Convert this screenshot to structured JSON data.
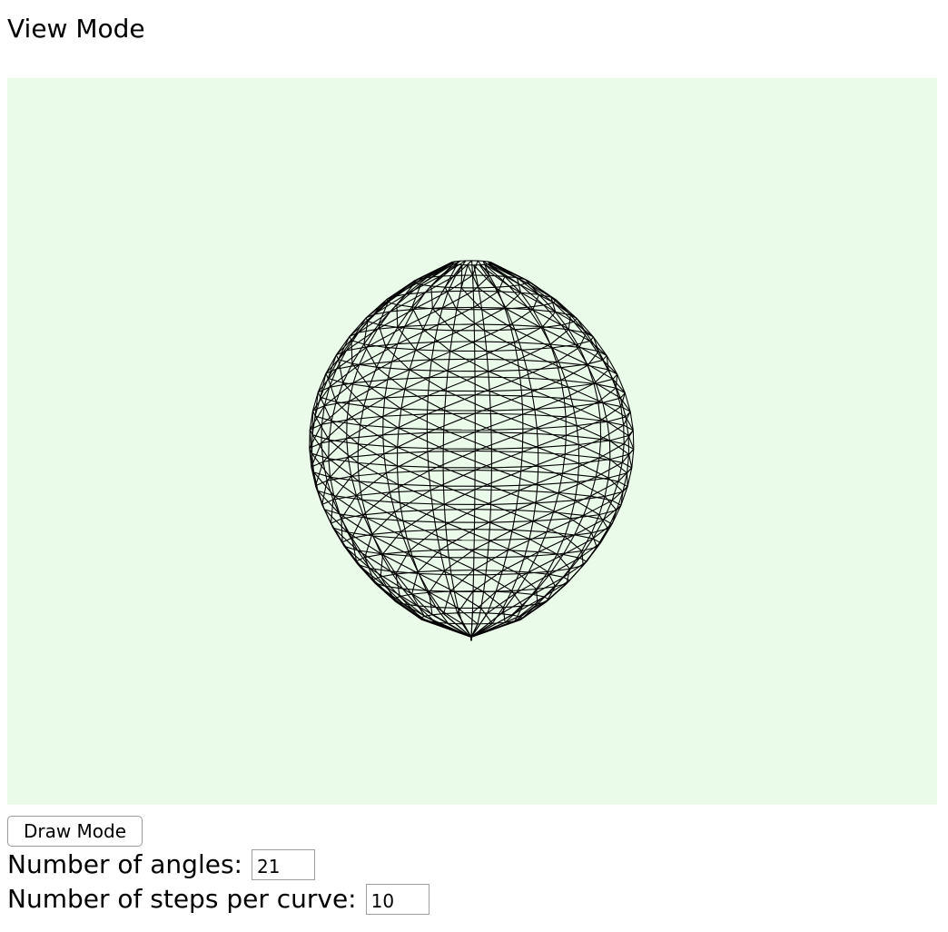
{
  "page": {
    "title": "View Mode",
    "background": "#ffffff",
    "canvas_background": "#eafce9",
    "mesh_color": "#000000"
  },
  "viewer": {
    "shape": "egg-shaped wireframe surface of revolution"
  },
  "controls": {
    "mode_button_label": "Draw Mode",
    "angles_label": "Number of angles:",
    "angles_value": "21",
    "steps_label": "Number of steps per curve:",
    "steps_value": "10"
  }
}
